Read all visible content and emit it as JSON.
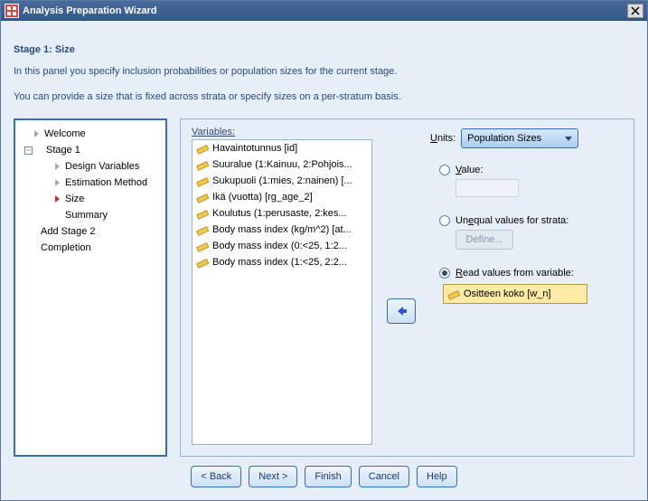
{
  "title": "Analysis Preparation Wizard",
  "heading": "Stage 1: Size",
  "desc1": "In this panel you specify inclusion probabilities or population sizes for the current stage.",
  "desc2": "You can provide a size that is fixed across strata or specify sizes on a per-stratum basis.",
  "tree": {
    "welcome": "Welcome",
    "stage1": "Stage 1",
    "design": "Design Variables",
    "estimation": "Estimation Method",
    "size": "Size",
    "summary": "Summary",
    "addstage": "Add Stage 2",
    "completion": "Completion"
  },
  "varlabel": "Variables:",
  "variables": [
    "Havaintotunnus [id]",
    "Suuralue (1:Kainuu, 2:Pohjois...",
    "Sukupuoli (1:mies, 2:nainen) [...",
    "Ikä (vuotta) [rg_age_2]",
    "Koulutus (1:perusaste, 2:kes...",
    "Body mass index (kg/m^2) [at...",
    "Body mass index (0:<25, 1:2...",
    "Body mass index (1:<25, 2:2..."
  ],
  "units": {
    "label": "Units:",
    "value": "Population Sizes"
  },
  "opt": {
    "value_label": "Value:",
    "unequal_label": "Unequal values for strata:",
    "define": "Define...",
    "readvar_label": "Read values from variable:",
    "readvar_value": "Ositteen koko [w_n]"
  },
  "buttons": {
    "back": "< Back",
    "next": "Next >",
    "finish": "Finish",
    "cancel": "Cancel",
    "help": "Help"
  }
}
